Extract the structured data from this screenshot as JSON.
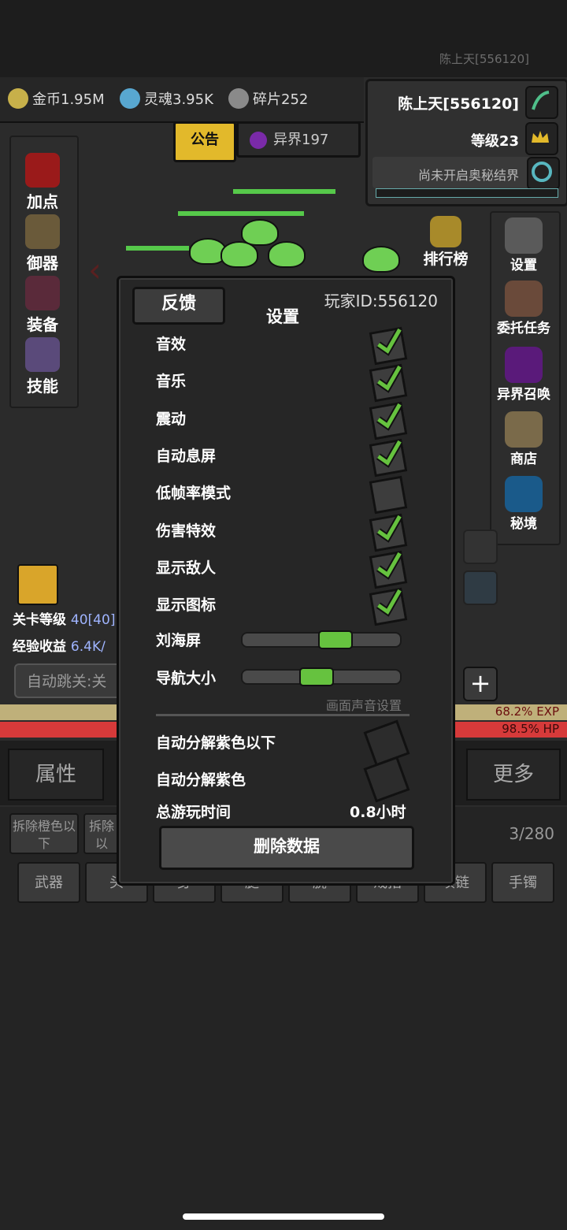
{
  "header": {
    "player_top": "陈上天[556120]"
  },
  "resources": [
    {
      "label": "金币1.95M",
      "icon": "gold-coin-icon",
      "color": "#c7b04a"
    },
    {
      "label": "灵魂3.95K",
      "icon": "soul-icon",
      "color": "#58a7d0"
    },
    {
      "label": "碎片252",
      "icon": "shard-icon",
      "color": "#8a8a8a"
    }
  ],
  "info_panel": {
    "name": "陈上天[556120]",
    "level": "等级23",
    "seal_text": "尚未开启奥秘结界"
  },
  "tabs": {
    "notice": "公告",
    "realm": "异界197"
  },
  "left_menu": [
    "加点",
    "御器",
    "装备",
    "技能"
  ],
  "right_menu": [
    "排行榜",
    "设置",
    "委托任务",
    "异界召唤",
    "商店",
    "秘境"
  ],
  "stats": {
    "stage_label": "关卡等级",
    "stage_value": "40[40]",
    "exp_label": "经验收益",
    "exp_value": "6.4K/",
    "auto_jump": "自动跳关:关"
  },
  "bars": {
    "exp": "68.2% EXP",
    "hp": "98.5% HP",
    "exp_fraction": 0.682,
    "hp_fraction": 0.985
  },
  "bottom_tabs": {
    "left": "属性",
    "right": "更多"
  },
  "inventory": {
    "dismantle_orange": "拆除橙色以下",
    "dismantle_2": "拆除以",
    "count": "3/280",
    "slots": [
      "武器",
      "头",
      "身",
      "腿",
      "腕",
      "戒指",
      "项链",
      "手镯"
    ]
  },
  "settings_dialog": {
    "feedback": "反馈",
    "title": "设置",
    "player_id": "玩家ID:556120",
    "options": [
      {
        "label": "音效",
        "checked": true
      },
      {
        "label": "音乐",
        "checked": true
      },
      {
        "label": "震动",
        "checked": true
      },
      {
        "label": "自动息屏",
        "checked": true
      },
      {
        "label": "低帧率模式",
        "checked": false
      },
      {
        "label": "伤害特效",
        "checked": true
      },
      {
        "label": "显示敌人",
        "checked": true
      },
      {
        "label": "显示图标",
        "checked": true
      }
    ],
    "sliders": [
      {
        "label": "刘海屏",
        "value": 0.6
      },
      {
        "label": "导航大小",
        "value": 0.45
      }
    ],
    "section_title": "画面声音设置",
    "auto_options": [
      {
        "label": "自动分解紫色以下",
        "checked": false
      },
      {
        "label": "自动分解紫色",
        "checked": false
      }
    ],
    "playtime_label": "总游玩时间",
    "playtime_value": "0.8小时",
    "delete_button": "删除数据"
  },
  "colors": {
    "accent_gold": "#e2b92b",
    "check_green": "#66c23f",
    "hp_red": "#d63a3a"
  }
}
